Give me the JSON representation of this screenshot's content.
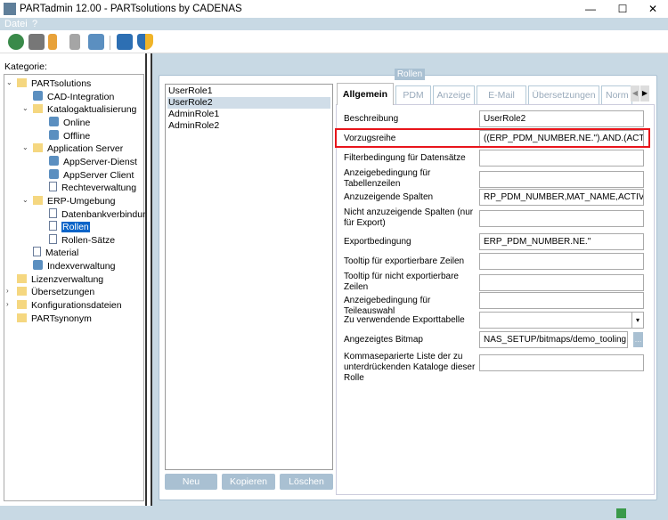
{
  "window": {
    "title": "PARTadmin 12.00 - PARTsolutions by CADENAS",
    "minimize": "—",
    "maximize": "☐",
    "close": "✕"
  },
  "menu": [
    "Datei",
    "?"
  ],
  "toolbar": [
    "globe-sync",
    "printer",
    "hierarchy",
    "keys",
    "settings",
    "save",
    "shield"
  ],
  "left": {
    "label": "Kategorie:",
    "tree": [
      {
        "label": "PARTsolutions",
        "level": 0,
        "icon": "folder",
        "exp": "v"
      },
      {
        "label": "CAD-Integration",
        "level": 1,
        "icon": "ico"
      },
      {
        "label": "Katalogaktualisierung",
        "level": 1,
        "icon": "folder",
        "exp": "v"
      },
      {
        "label": "Online",
        "level": 2,
        "icon": "ico"
      },
      {
        "label": "Offline",
        "level": 2,
        "icon": "ico"
      },
      {
        "label": "Application Server",
        "level": 1,
        "icon": "folder",
        "exp": "v"
      },
      {
        "label": "AppServer-Dienst",
        "level": 2,
        "icon": "ico"
      },
      {
        "label": "AppServer Client",
        "level": 2,
        "icon": "ico"
      },
      {
        "label": "Rechteverwaltung",
        "level": 2,
        "icon": "doc"
      },
      {
        "label": "ERP-Umgebung",
        "level": 1,
        "icon": "folder",
        "exp": "v"
      },
      {
        "label": "Datenbankverbindung",
        "level": 2,
        "icon": "doc"
      },
      {
        "label": "Rollen",
        "level": 2,
        "icon": "doc",
        "selected": true
      },
      {
        "label": "Rollen-Sätze",
        "level": 2,
        "icon": "doc"
      },
      {
        "label": "Material",
        "level": 1,
        "icon": "doc"
      },
      {
        "label": "Indexverwaltung",
        "level": 1,
        "icon": "ico"
      },
      {
        "label": "Lizenzverwaltung",
        "level": 0,
        "icon": "folder"
      },
      {
        "label": "Übersetzungen",
        "level": 0,
        "icon": "folder",
        "exp": ">"
      },
      {
        "label": "Konfigurationsdateien",
        "level": 0,
        "icon": "folder",
        "exp": ">"
      },
      {
        "label": "PARTsynonym",
        "level": 0,
        "icon": "folder"
      }
    ]
  },
  "group": {
    "legend": "Rollen",
    "roles": [
      "UserRole1",
      "UserRole2",
      "AdminRole1",
      "AdminRole2"
    ],
    "selected_role": 1,
    "buttons": {
      "new": "Neu",
      "copy": "Kopieren",
      "delete": "Löschen"
    },
    "tabs": [
      "Allgemein",
      "PDM",
      "Anzeige",
      "E-Mail",
      "Übersetzungen",
      "Norm"
    ],
    "active_tab": 0,
    "fields": [
      {
        "label": "Beschreibung",
        "value": "UserRole2"
      },
      {
        "label": "Vorzugsreihe",
        "value": "((ERP_PDM_NUMBER.NE.'').AND.(ACTIVE_STA"
      },
      {
        "label": "Filterbedingung für Datensätze",
        "value": ""
      },
      {
        "label": "Anzeigebedingung für Tabellenzeilen",
        "value": ""
      },
      {
        "label": "Anzuzeigende Spalten",
        "value": "RP_PDM_NUMBER,MAT_NAME,ACTIVE_STATE"
      },
      {
        "label": "Nicht anzuzeigende Spalten (nur für Export)",
        "value": ""
      },
      {
        "label": "Exportbedingung",
        "value": "ERP_PDM_NUMBER.NE.''"
      },
      {
        "label": "Tooltip für exportierbare Zeilen",
        "value": ""
      },
      {
        "label": "Tooltip für nicht exportierbare Zeilen",
        "value": ""
      },
      {
        "label": "Anzeigebedingung für Teileauswahl",
        "value": ""
      },
      {
        "label": "Zu verwendende Exporttabelle",
        "value": "",
        "type": "dropdown"
      },
      {
        "label": "Angezeigtes Bitmap",
        "value": "NAS_SETUP/bitmaps/demo_tooling.bmp",
        "type": "browse"
      },
      {
        "label": "Kommaseparierte Liste der zu unterdrückenden Kataloge dieser Rolle",
        "value": ""
      }
    ]
  },
  "highlight_color": "#e8151b"
}
